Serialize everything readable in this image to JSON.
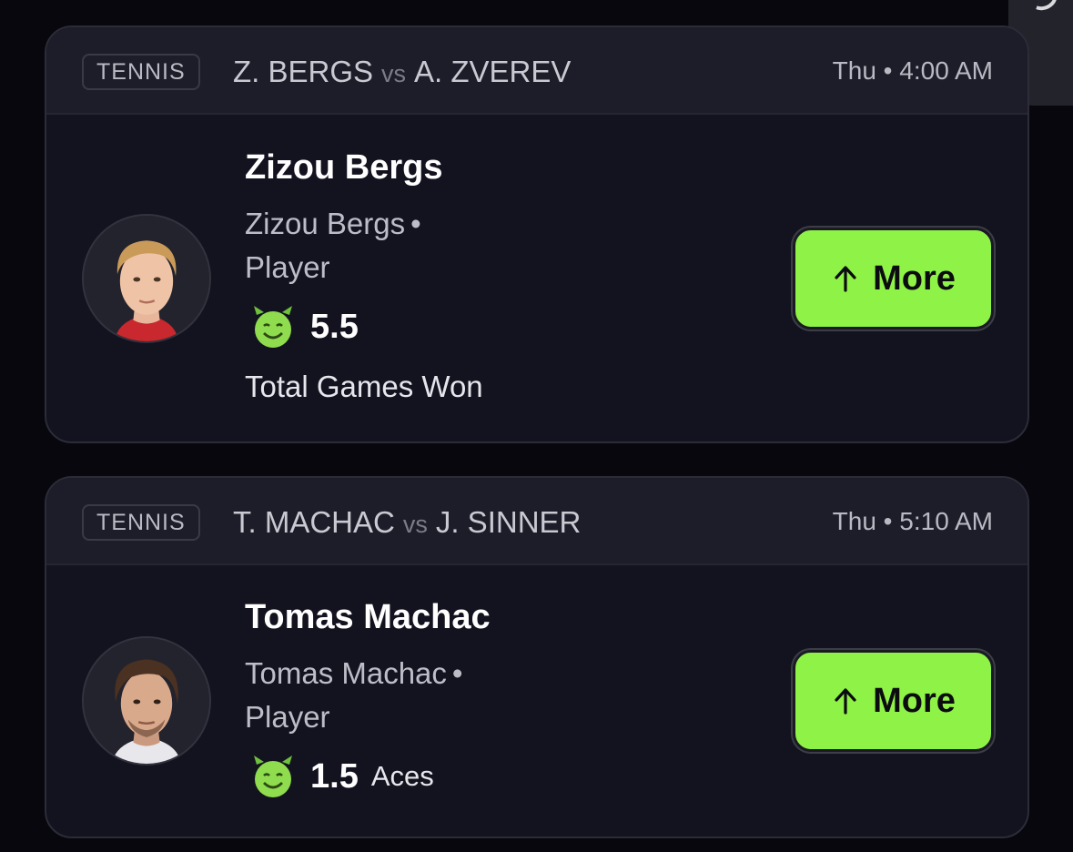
{
  "picks": [
    {
      "sport": "TENNIS",
      "team_a": "Z. BERGS",
      "vs": "vs",
      "team_b": "A. ZVEREV",
      "time": "Thu • 4:00 AM",
      "player_name": "Zizou Bergs",
      "player_sub_name": "Zizou Bergs",
      "player_role": "Player",
      "line": "5.5",
      "stat": "Total Games Won",
      "button_label": "More",
      "button_icon": "arrow-up-icon"
    },
    {
      "sport": "TENNIS",
      "team_a": "T. MACHAC",
      "vs": "vs",
      "team_b": "J. SINNER",
      "time": "Thu • 5:10 AM",
      "player_name": "Tomas Machac",
      "player_sub_name": "Tomas Machac",
      "player_role": "Player",
      "line": "1.5",
      "stat": "Aces",
      "button_label": "More",
      "button_icon": "arrow-up-icon"
    }
  ],
  "colors": {
    "accent_green": "#8ff247",
    "card_bg": "#131320",
    "header_bg": "#1d1d29",
    "page_bg": "#07070d"
  }
}
